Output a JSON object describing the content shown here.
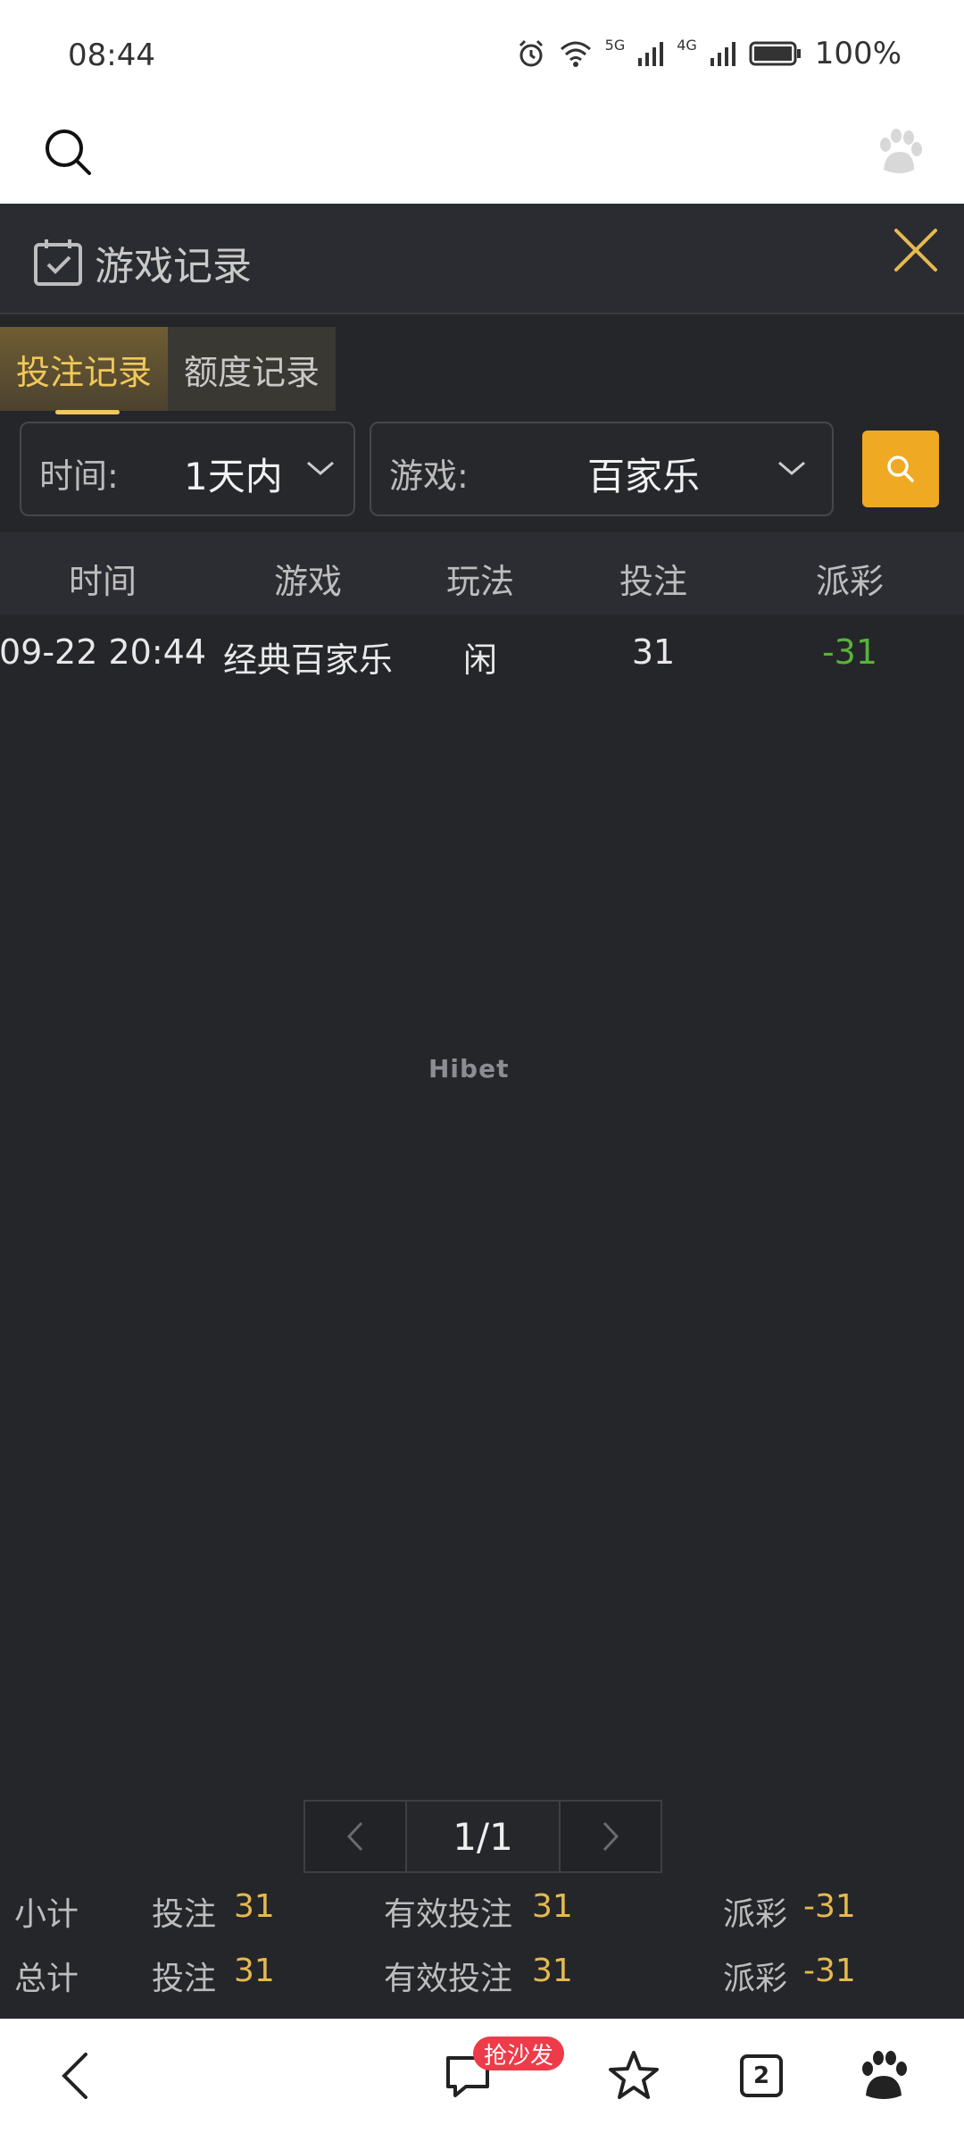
{
  "status_bar": {
    "time": "08:44",
    "net1": "5G",
    "net2": "4G",
    "battery": "100%"
  },
  "dialog": {
    "title": "游戏记录",
    "tabs": [
      {
        "label": "投注记录",
        "active": true
      },
      {
        "label": "额度记录",
        "active": false
      }
    ],
    "filters": {
      "time_label": "时间:",
      "time_value": "1天内",
      "game_label": "游戏:",
      "game_value": "百家乐"
    },
    "table": {
      "headers": [
        "时间",
        "游戏",
        "玩法",
        "投注",
        "派彩"
      ],
      "rows": [
        [
          "09-22 20:44",
          "经典百家乐",
          "闲",
          "31",
          "-31"
        ]
      ]
    },
    "watermark": "Hibet",
    "pagination": {
      "page": "1/1"
    },
    "subtotal": {
      "label": "小计",
      "bet_label": "投注",
      "bet": "31",
      "valid_label": "有效投注",
      "valid": "31",
      "payout_label": "派彩",
      "payout": "-31"
    },
    "total": {
      "label": "总计",
      "bet_label": "投注",
      "bet": "31",
      "valid_label": "有效投注",
      "valid": "31",
      "payout_label": "派彩",
      "payout": "-31"
    }
  },
  "bottom_bar": {
    "comment_badge": "抢沙发",
    "tab_count": "2"
  },
  "colors": {
    "accent": "#f0a922",
    "gold": "#e6b94f",
    "negative": "#58b33a",
    "background": "#25262a"
  }
}
